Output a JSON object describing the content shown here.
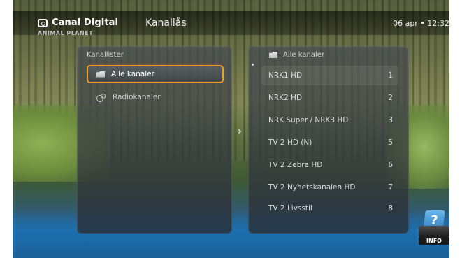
{
  "header": {
    "brand": "Canal Digital",
    "title": "Kanallås",
    "datetime": "06 apr • 12:32",
    "channel_watermark": "ANIMAL PLANET"
  },
  "left_panel": {
    "heading": "Kanallister",
    "items": [
      {
        "label": "Alle kanaler",
        "icon": "folder-icon",
        "selected": true
      },
      {
        "label": "Radiokanaler",
        "icon": "radio-icon",
        "selected": false
      }
    ]
  },
  "right_panel": {
    "heading": "Alle kanaler",
    "channels": [
      {
        "name": "NRK1 HD",
        "number": "1"
      },
      {
        "name": "NRK2 HD",
        "number": "2"
      },
      {
        "name": "NRK Super / NRK3 HD",
        "number": "3"
      },
      {
        "name": "TV 2 HD (N)",
        "number": "5"
      },
      {
        "name": "TV 2 Zebra HD",
        "number": "6"
      },
      {
        "name": "TV 2 Nyhetskanalen HD",
        "number": "7"
      },
      {
        "name": "TV 2 Livsstil",
        "number": "8"
      }
    ]
  },
  "info_button": {
    "label": "INFO",
    "icon": "question-icon",
    "glyph": "?"
  },
  "colors": {
    "focus": "#f0a01e",
    "info": "#2c7cc0"
  }
}
